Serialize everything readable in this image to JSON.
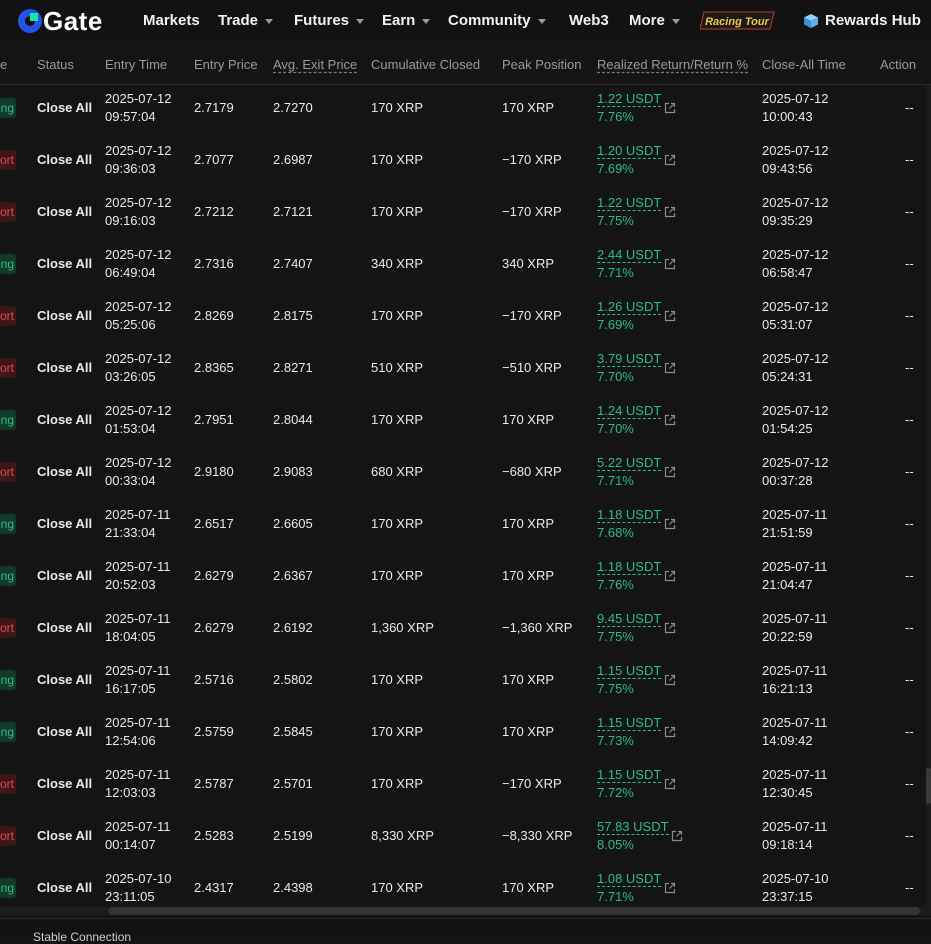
{
  "nav": {
    "logo_text": "Gate",
    "items": [
      {
        "label": "Markets",
        "caret": false
      },
      {
        "label": "Trade",
        "caret": true
      },
      {
        "label": "Futures",
        "caret": true
      },
      {
        "label": "Earn",
        "caret": true
      },
      {
        "label": "Community",
        "caret": true
      },
      {
        "label": "Web3",
        "caret": false
      },
      {
        "label": "More",
        "caret": true
      }
    ],
    "racing_label": "Racing Tour",
    "rewards_label": "Rewards Hub"
  },
  "colors": {
    "green": "#2ebd85",
    "red": "#e4474f",
    "bg": "#141414"
  },
  "table": {
    "headers": {
      "side": "e",
      "status": "Status",
      "entry_time": "Entry Time",
      "entry_price": "Entry Price",
      "avg_exit": "Avg. Exit Price",
      "cum_closed": "Cumulative Closed",
      "peak": "Peak Position",
      "realized": "Realized Return/Return %",
      "close_time": "Close-All Time",
      "action": "Action"
    },
    "rows": [
      {
        "side": "ng",
        "side_type": "long",
        "status": "Close All",
        "entry_date": "2025-07-12",
        "entry_clock": "09:57:04",
        "entry_price": "2.7179",
        "avg_exit": "2.7270",
        "cum_closed": "170 XRP",
        "peak": "170 XRP",
        "pnl": "1.22 USDT",
        "pct": "7.76%",
        "close_date": "2025-07-12",
        "close_clock": "10:00:43",
        "action": "--"
      },
      {
        "side": "ort",
        "side_type": "short",
        "status": "Close All",
        "entry_date": "2025-07-12",
        "entry_clock": "09:36:03",
        "entry_price": "2.7077",
        "avg_exit": "2.6987",
        "cum_closed": "170 XRP",
        "peak": "−170 XRP",
        "pnl": "1.20 USDT",
        "pct": "7.69%",
        "close_date": "2025-07-12",
        "close_clock": "09:43:56",
        "action": "--"
      },
      {
        "side": "ort",
        "side_type": "short",
        "status": "Close All",
        "entry_date": "2025-07-12",
        "entry_clock": "09:16:03",
        "entry_price": "2.7212",
        "avg_exit": "2.7121",
        "cum_closed": "170 XRP",
        "peak": "−170 XRP",
        "pnl": "1.22 USDT",
        "pct": "7.75%",
        "close_date": "2025-07-12",
        "close_clock": "09:35:29",
        "action": "--"
      },
      {
        "side": "ng",
        "side_type": "long",
        "status": "Close All",
        "entry_date": "2025-07-12",
        "entry_clock": "06:49:04",
        "entry_price": "2.7316",
        "avg_exit": "2.7407",
        "cum_closed": "340 XRP",
        "peak": "340 XRP",
        "pnl": "2.44 USDT",
        "pct": "7.71%",
        "close_date": "2025-07-12",
        "close_clock": "06:58:47",
        "action": "--"
      },
      {
        "side": "ort",
        "side_type": "short",
        "status": "Close All",
        "entry_date": "2025-07-12",
        "entry_clock": "05:25:06",
        "entry_price": "2.8269",
        "avg_exit": "2.8175",
        "cum_closed": "170 XRP",
        "peak": "−170 XRP",
        "pnl": "1.26 USDT",
        "pct": "7.69%",
        "close_date": "2025-07-12",
        "close_clock": "05:31:07",
        "action": "--"
      },
      {
        "side": "ort",
        "side_type": "short",
        "status": "Close All",
        "entry_date": "2025-07-12",
        "entry_clock": "03:26:05",
        "entry_price": "2.8365",
        "avg_exit": "2.8271",
        "cum_closed": "510 XRP",
        "peak": "−510 XRP",
        "pnl": "3.79 USDT",
        "pct": "7.70%",
        "close_date": "2025-07-12",
        "close_clock": "05:24:31",
        "action": "--"
      },
      {
        "side": "ng",
        "side_type": "long",
        "status": "Close All",
        "entry_date": "2025-07-12",
        "entry_clock": "01:53:04",
        "entry_price": "2.7951",
        "avg_exit": "2.8044",
        "cum_closed": "170 XRP",
        "peak": "170 XRP",
        "pnl": "1.24 USDT",
        "pct": "7.70%",
        "close_date": "2025-07-12",
        "close_clock": "01:54:25",
        "action": "--"
      },
      {
        "side": "ort",
        "side_type": "short",
        "status": "Close All",
        "entry_date": "2025-07-12",
        "entry_clock": "00:33:04",
        "entry_price": "2.9180",
        "avg_exit": "2.9083",
        "cum_closed": "680 XRP",
        "peak": "−680 XRP",
        "pnl": "5.22 USDT",
        "pct": "7.71%",
        "close_date": "2025-07-12",
        "close_clock": "00:37:28",
        "action": "--"
      },
      {
        "side": "ng",
        "side_type": "long",
        "status": "Close All",
        "entry_date": "2025-07-11",
        "entry_clock": "21:33:04",
        "entry_price": "2.6517",
        "avg_exit": "2.6605",
        "cum_closed": "170 XRP",
        "peak": "170 XRP",
        "pnl": "1.18 USDT",
        "pct": "7.68%",
        "close_date": "2025-07-11",
        "close_clock": "21:51:59",
        "action": "--"
      },
      {
        "side": "ng",
        "side_type": "long",
        "status": "Close All",
        "entry_date": "2025-07-11",
        "entry_clock": "20:52:03",
        "entry_price": "2.6279",
        "avg_exit": "2.6367",
        "cum_closed": "170 XRP",
        "peak": "170 XRP",
        "pnl": "1.18 USDT",
        "pct": "7.76%",
        "close_date": "2025-07-11",
        "close_clock": "21:04:47",
        "action": "--"
      },
      {
        "side": "ort",
        "side_type": "short",
        "status": "Close All",
        "entry_date": "2025-07-11",
        "entry_clock": "18:04:05",
        "entry_price": "2.6279",
        "avg_exit": "2.6192",
        "cum_closed": "1,360 XRP",
        "peak": "−1,360 XRP",
        "pnl": "9.45 USDT",
        "pct": "7.75%",
        "close_date": "2025-07-11",
        "close_clock": "20:22:59",
        "action": "--"
      },
      {
        "side": "ng",
        "side_type": "long",
        "status": "Close All",
        "entry_date": "2025-07-11",
        "entry_clock": "16:17:05",
        "entry_price": "2.5716",
        "avg_exit": "2.5802",
        "cum_closed": "170 XRP",
        "peak": "170 XRP",
        "pnl": "1.15 USDT",
        "pct": "7.75%",
        "close_date": "2025-07-11",
        "close_clock": "16:21:13",
        "action": "--"
      },
      {
        "side": "ng",
        "side_type": "long",
        "status": "Close All",
        "entry_date": "2025-07-11",
        "entry_clock": "12:54:06",
        "entry_price": "2.5759",
        "avg_exit": "2.5845",
        "cum_closed": "170 XRP",
        "peak": "170 XRP",
        "pnl": "1.15 USDT",
        "pct": "7.73%",
        "close_date": "2025-07-11",
        "close_clock": "14:09:42",
        "action": "--"
      },
      {
        "side": "ort",
        "side_type": "short",
        "status": "Close All",
        "entry_date": "2025-07-11",
        "entry_clock": "12:03:03",
        "entry_price": "2.5787",
        "avg_exit": "2.5701",
        "cum_closed": "170 XRP",
        "peak": "−170 XRP",
        "pnl": "1.15 USDT",
        "pct": "7.72%",
        "close_date": "2025-07-11",
        "close_clock": "12:30:45",
        "action": "--"
      },
      {
        "side": "ort",
        "side_type": "short",
        "status": "Close All",
        "entry_date": "2025-07-11",
        "entry_clock": "00:14:07",
        "entry_price": "2.5283",
        "avg_exit": "2.5199",
        "cum_closed": "8,330 XRP",
        "peak": "−8,330 XRP",
        "pnl": "57.83 USDT",
        "pct": "8.05%",
        "close_date": "2025-07-11",
        "close_clock": "09:18:14",
        "action": "--"
      },
      {
        "side": "ng",
        "side_type": "long",
        "status": "Close All",
        "entry_date": "2025-07-10",
        "entry_clock": "23:11:05",
        "entry_price": "2.4317",
        "avg_exit": "2.4398",
        "cum_closed": "170 XRP",
        "peak": "170 XRP",
        "pnl": "1.08 USDT",
        "pct": "7.71%",
        "close_date": "2025-07-10",
        "close_clock": "23:37:15",
        "action": "--"
      }
    ]
  },
  "footer": {
    "connection_status": "Stable Connection"
  }
}
